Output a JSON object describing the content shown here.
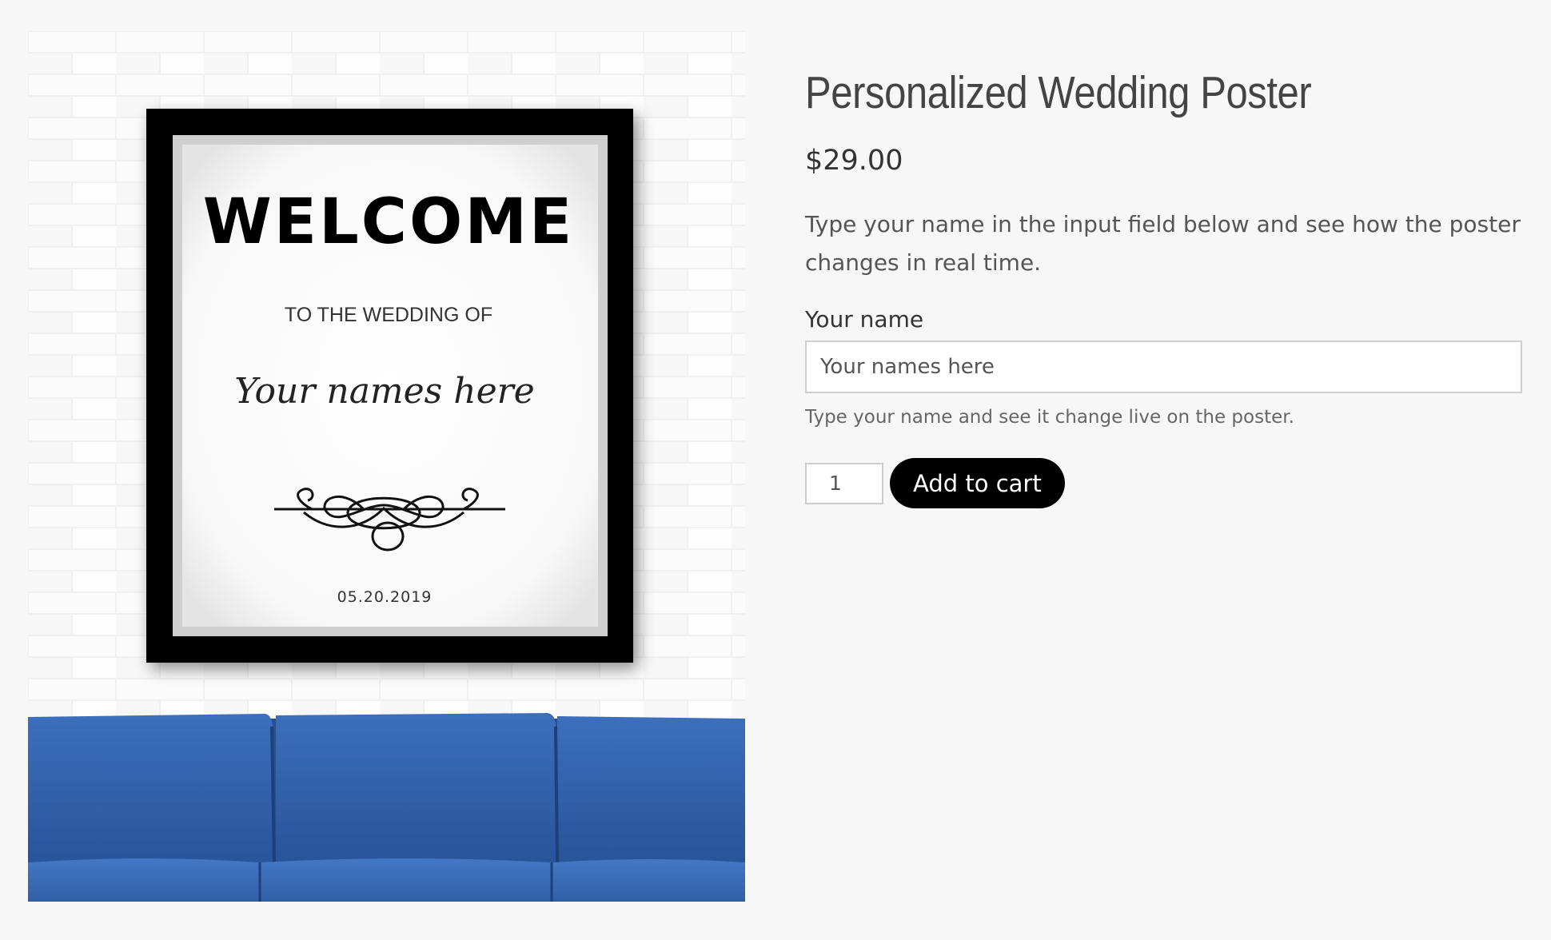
{
  "product": {
    "title": "Personalized Wedding Poster",
    "price": "$29.00",
    "description": "Type your name in the input field below and see how the poster changes in real time."
  },
  "form": {
    "name_label": "Your name",
    "name_placeholder": "Your names here",
    "name_help": "Type your name and see it change live on the poster.",
    "quantity": "1",
    "add_to_cart_label": "Add to cart"
  },
  "poster": {
    "headline": "WELCOME",
    "subheading": "TO THE WEDDING OF",
    "names": "Your names here",
    "date": "05.20.2019"
  },
  "colors": {
    "page_background": "#f7f7f7",
    "brick_wall": "#f1f1f1",
    "frame": "#000000",
    "sofa": "#2f62ad",
    "button": "#000000"
  }
}
